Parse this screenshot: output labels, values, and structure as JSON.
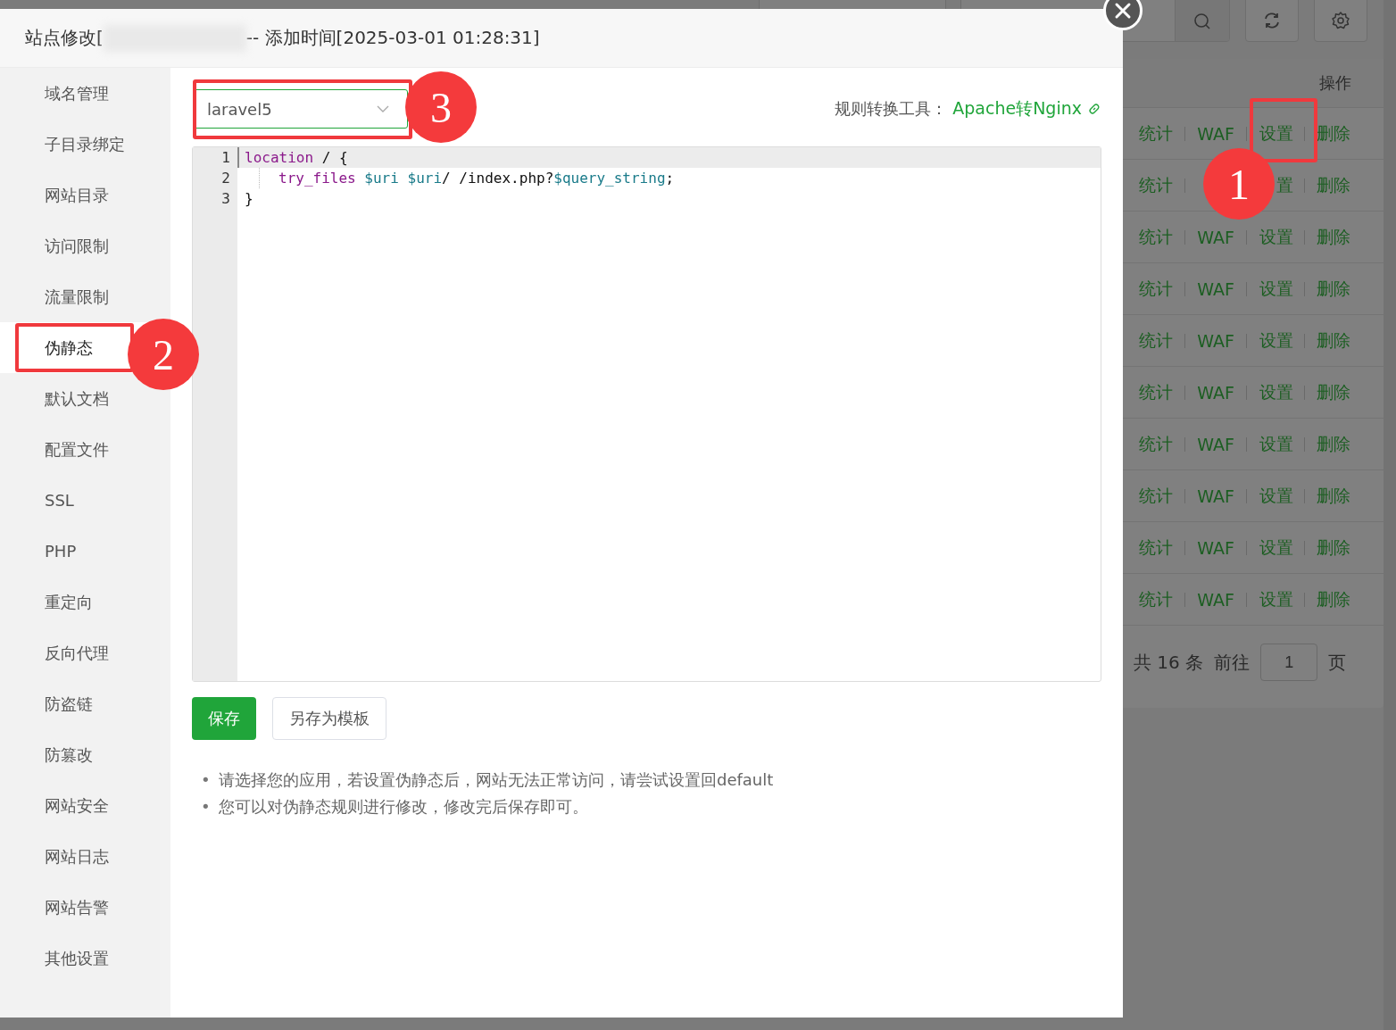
{
  "background": {
    "table": {
      "columns": [
        "操作"
      ],
      "rows": [
        {
          "actions": [
            "统计",
            "WAF",
            "设置",
            "删除"
          ]
        },
        {
          "actions": [
            "统计",
            {
              "kind": "covered"
            },
            "置",
            "删除"
          ]
        },
        {
          "actions": [
            "统计",
            "WAF",
            "设置",
            "删除"
          ]
        },
        {
          "actions": [
            "统计",
            "WAF",
            "设置",
            "删除"
          ]
        },
        {
          "actions": [
            "统计",
            "WAF",
            "设置",
            "删除"
          ]
        },
        {
          "actions": [
            "统计",
            "WAF",
            "设置",
            "删除"
          ]
        },
        {
          "actions": [
            "统计",
            "WAF",
            "设置",
            "删除"
          ]
        },
        {
          "actions": [
            "统计",
            "WAF",
            "设置",
            "删除"
          ]
        },
        {
          "actions": [
            "统计",
            "WAF",
            "设置",
            "删除"
          ]
        },
        {
          "actions": [
            "统计",
            "WAF",
            "设置",
            "删除"
          ]
        }
      ]
    },
    "pagination": {
      "total": "共 16 条",
      "goto": "前往",
      "page": "1",
      "unit": "页"
    }
  },
  "dialog": {
    "title_prefix": "站点修改[",
    "title_suffix": "-- 添加时间[2025-03-01 01:28:31]",
    "sidebar": {
      "items": [
        {
          "label": "域名管理",
          "selected": false
        },
        {
          "label": "子目录绑定",
          "selected": false
        },
        {
          "label": "网站目录",
          "selected": false
        },
        {
          "label": "访问限制",
          "selected": false
        },
        {
          "label": "流量限制",
          "selected": false
        },
        {
          "label": "伪静态",
          "selected": true
        },
        {
          "label": "默认文档",
          "selected": false
        },
        {
          "label": "配置文件",
          "selected": false
        },
        {
          "label": "SSL",
          "selected": false
        },
        {
          "label": "PHP",
          "selected": false
        },
        {
          "label": "重定向",
          "selected": false
        },
        {
          "label": "反向代理",
          "selected": false
        },
        {
          "label": "防盗链",
          "selected": false
        },
        {
          "label": "防篡改",
          "selected": false
        },
        {
          "label": "网站安全",
          "selected": false
        },
        {
          "label": "网站日志",
          "selected": false
        },
        {
          "label": "网站告警",
          "selected": false
        },
        {
          "label": "其他设置",
          "selected": false
        }
      ]
    },
    "template_select": {
      "value": "laravel5"
    },
    "converter": {
      "label": "规则转换工具：",
      "link": "Apache转Nginx"
    },
    "editor": {
      "lines": [
        {
          "number": "1",
          "tokens": [
            {
              "kind": "keyword",
              "text": "location"
            },
            {
              "kind": "plain",
              "text": " / {"
            }
          ]
        },
        {
          "number": "2",
          "indented": true,
          "tokens": [
            {
              "kind": "keyword",
              "text": "try_files"
            },
            {
              "kind": "variable",
              "text": " $uri"
            },
            {
              "kind": "variable",
              "text": " $uri"
            },
            {
              "kind": "plain",
              "text": "/ /index.php?"
            },
            {
              "kind": "variable",
              "text": "$query_string"
            },
            {
              "kind": "plain",
              "text": ";"
            }
          ]
        },
        {
          "number": "3",
          "tokens": [
            {
              "kind": "plain",
              "text": "}"
            }
          ]
        }
      ]
    },
    "buttons": [
      {
        "label": "保存",
        "kind": "primary"
      },
      {
        "label": "另存为模板",
        "kind": "default"
      }
    ],
    "notes": [
      {
        "bullet": "•",
        "text": "请选择您的应用，若设置伪静态后，网站无法正常访问，请尝试设置回default"
      },
      {
        "bullet": "•",
        "text": "您可以对伪静态规则进行修改，修改完后保存即可。"
      }
    ]
  },
  "annotations": [
    {
      "label": "1"
    },
    {
      "label": "2"
    },
    {
      "label": "3"
    }
  ]
}
